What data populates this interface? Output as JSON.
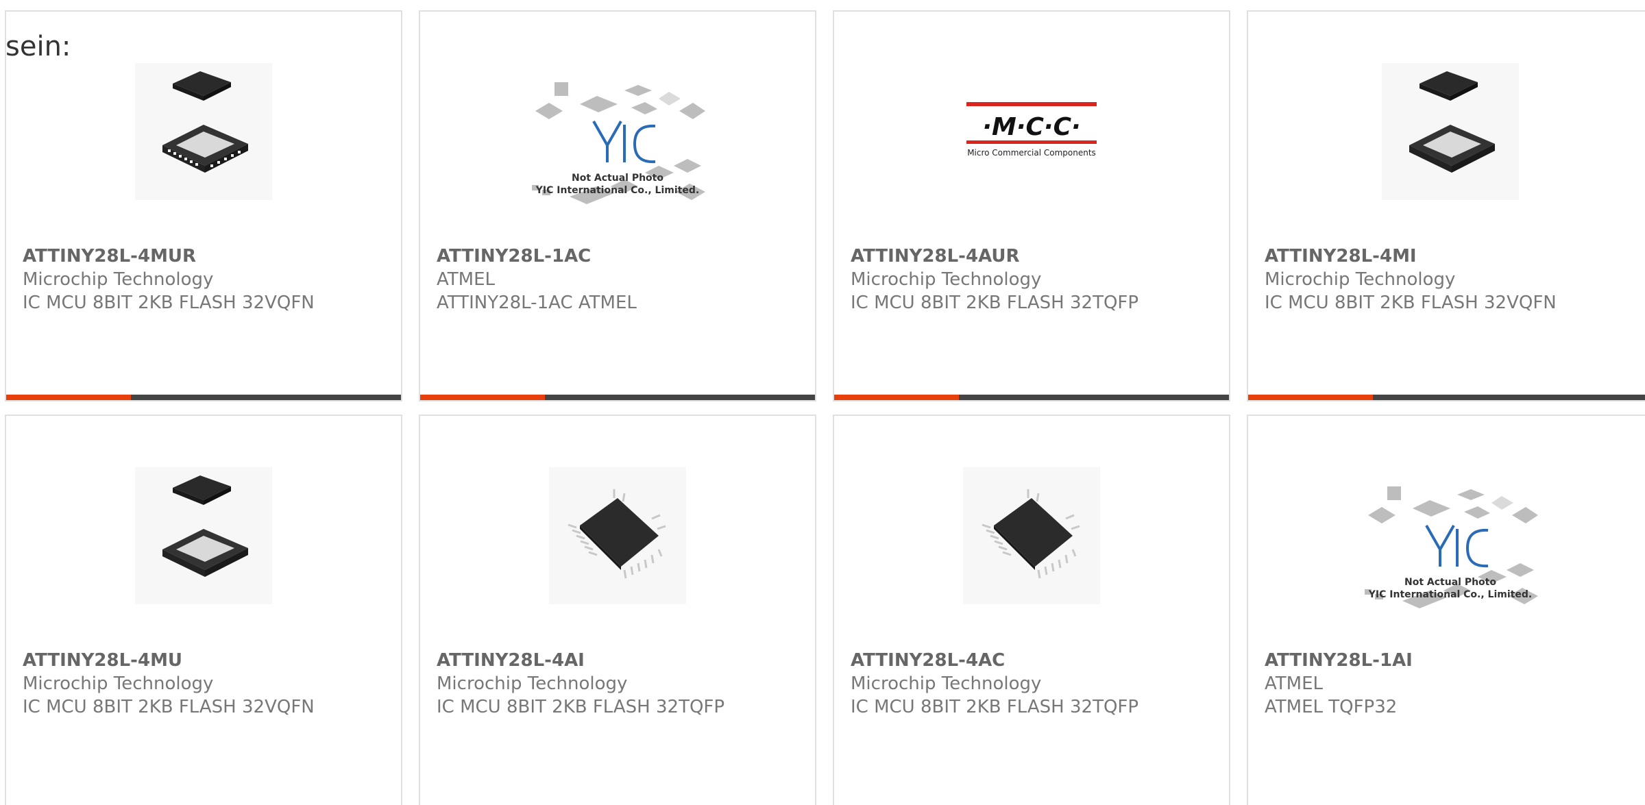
{
  "intro_text": "sein:",
  "accent_color": "#e8400c",
  "products": [
    {
      "part": "ATTINY28L-4MUR",
      "manufacturer": "Microchip Technology",
      "description": "IC MCU 8BIT 2KB FLASH 32VQFN",
      "image": "vqfn-chip-icon"
    },
    {
      "part": "ATTINY28L-1AC",
      "manufacturer": "ATMEL",
      "description": "ATTINY28L-1AC ATMEL",
      "image": "yic-placeholder-icon",
      "placeholder_line1": "Not Actual Photo",
      "placeholder_line2": "YIC International Co., Limited."
    },
    {
      "part": "ATTINY28L-4AUR",
      "manufacturer": "Microchip Technology",
      "description": "IC MCU 8BIT 2KB FLASH 32TQFP",
      "image": "mcc-logo-icon",
      "logo_text": "·M·C·C·",
      "logo_sub": "Micro Commercial Components"
    },
    {
      "part": "ATTINY28L-4MI",
      "manufacturer": "Microchip Technology",
      "description": "IC MCU 8BIT 2KB FLASH 32VQFN",
      "image": "vqfn-chip-icon"
    },
    {
      "part": "ATTINY28L-4MU",
      "manufacturer": "Microchip Technology",
      "description": "IC MCU 8BIT 2KB FLASH 32VQFN",
      "image": "vqfn-chip-icon"
    },
    {
      "part": "ATTINY28L-4AI",
      "manufacturer": "Microchip Technology",
      "description": "IC MCU 8BIT 2KB FLASH 32TQFP",
      "image": "tqfp-chip-icon"
    },
    {
      "part": "ATTINY28L-4AC",
      "manufacturer": "Microchip Technology",
      "description": "IC MCU 8BIT 2KB FLASH 32TQFP",
      "image": "tqfp-chip-icon"
    },
    {
      "part": "ATTINY28L-1AI",
      "manufacturer": "ATMEL",
      "description": "ATMEL TQFP32",
      "image": "yic-placeholder-icon",
      "placeholder_line1": "Not Actual Photo",
      "placeholder_line2": "YIC International Co., Limited."
    }
  ]
}
